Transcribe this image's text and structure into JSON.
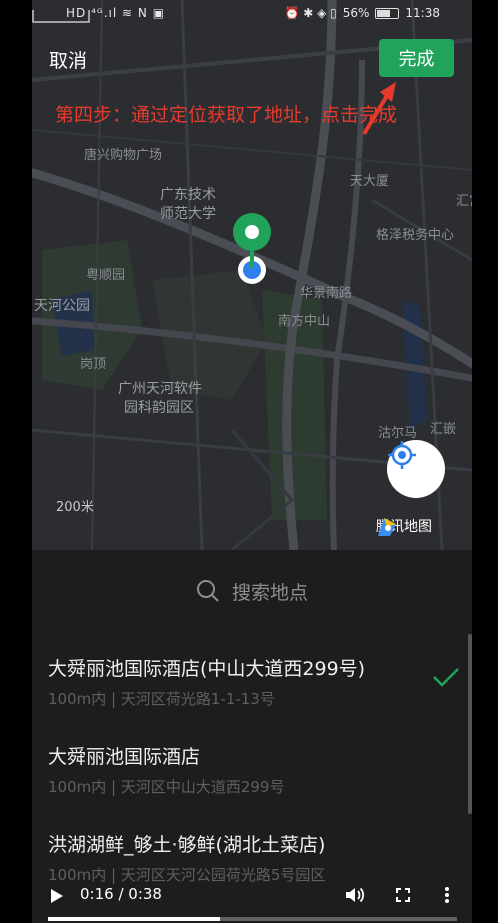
{
  "status_bar": {
    "left": "HD ⁴ᴳ.ıl ≋ N ▣",
    "battery": "56%",
    "time": "11:38"
  },
  "header": {
    "cancel_label": "取消",
    "done_label": "完成"
  },
  "annotation": "第四步：通过定位获取了地址，点击完成",
  "map": {
    "labels": [
      "唐兴购物广场",
      "广东技术",
      "师范大学",
      "粤顺园",
      "天河公园",
      "岗顶",
      "广州天河软件",
      "园科韵园区",
      "华景南路",
      "南方中山",
      "格泽税务中心",
      "天大厦",
      "汇嵌",
      "沽尔马",
      "汇宫"
    ],
    "scale": "200米",
    "provider": "腾讯地图"
  },
  "search": {
    "placeholder": "搜索地点"
  },
  "places": [
    {
      "name": "大舜丽池国际酒店(中山大道西299号)",
      "address": "100m内 | 天河区荷光路1-1-13号",
      "selected": true
    },
    {
      "name": "大舜丽池国际酒店",
      "address": "100m内 | 天河区中山大道西299号",
      "selected": false
    },
    {
      "name": "洪湖湖鲜_够土·够鲜(湖北土菜店)",
      "address": "100m内 | 天河区天河公园荷光路5号园区",
      "selected": false
    }
  ],
  "video": {
    "time": "0:16 / 0:38",
    "progress": 0.42
  },
  "colors": {
    "accent": "#21a35b",
    "annotation": "#e83a2c"
  }
}
